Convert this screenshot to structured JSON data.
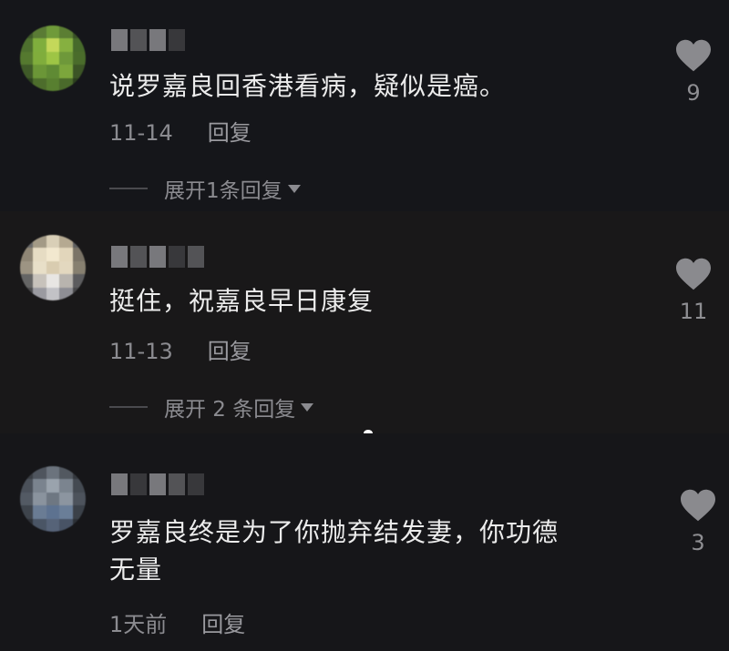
{
  "comments": [
    {
      "text": "说罗嘉良回香港看病，疑似是癌。",
      "date": "11-14",
      "reply_label": "回复",
      "expand_label": "展开1条回复",
      "like_count": "9"
    },
    {
      "text": "挺住，祝嘉良早日康复",
      "date": "11-13",
      "reply_label": "回复",
      "expand_label": "展开 2 条回复",
      "like_count": "11"
    },
    {
      "text_line1": "罗嘉良终是为了你抛弃结发妻，你功德",
      "text_line2": "无量",
      "date": "1天前",
      "reply_label": "回复",
      "like_count": "3"
    }
  ]
}
